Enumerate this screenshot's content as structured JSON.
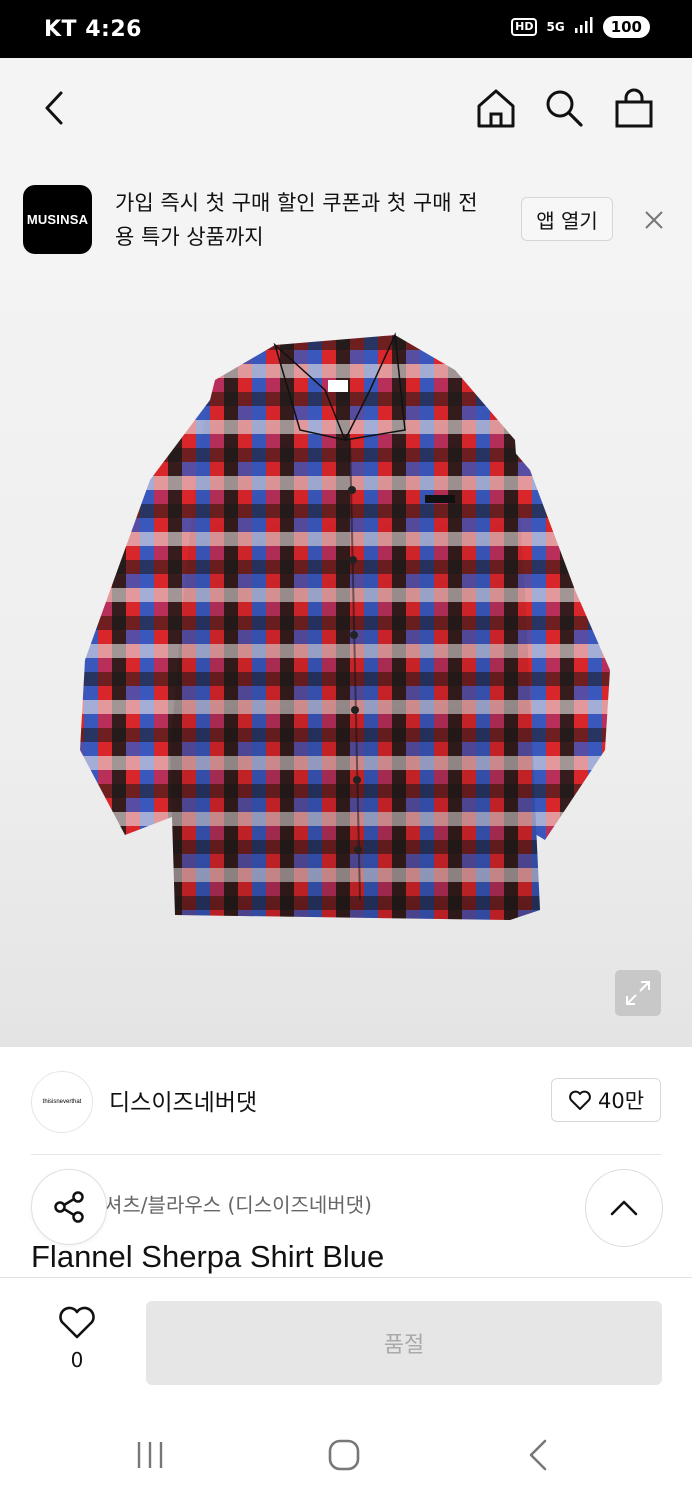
{
  "status_bar": {
    "carrier_time": "KT 4:26",
    "hd": "HD",
    "network": "5G",
    "battery": "100"
  },
  "nav": {
    "icons": [
      "back-icon",
      "home-icon",
      "search-icon",
      "shopping-bag-icon"
    ]
  },
  "banner": {
    "logo_text": "MUSINSA",
    "message": "가입 즉시 첫 구매 할인 쿠폰과 첫 구매 전용 특가 상품까지",
    "open_app_label": "앱 열기"
  },
  "product": {
    "image_desc_colors": [
      "#d9262b",
      "#1f5fd6",
      "#1a1a1a",
      "#e9e6e6"
    ],
    "brand_logo_text": "thisisneverthat",
    "brand_name": "디스이즈네버댓",
    "like_count": "40만",
    "category": "셔츠/블라우스 (디스이즈네버댓)",
    "name": "Flannel Sherpa Shirt Blue"
  },
  "purchase_bar": {
    "wish_count": "0",
    "soldout_label": "품절"
  },
  "colors": {
    "accent": "#000000",
    "soldout_bg": "#e6e6e6",
    "soldout_text": "#aaaaaa"
  }
}
